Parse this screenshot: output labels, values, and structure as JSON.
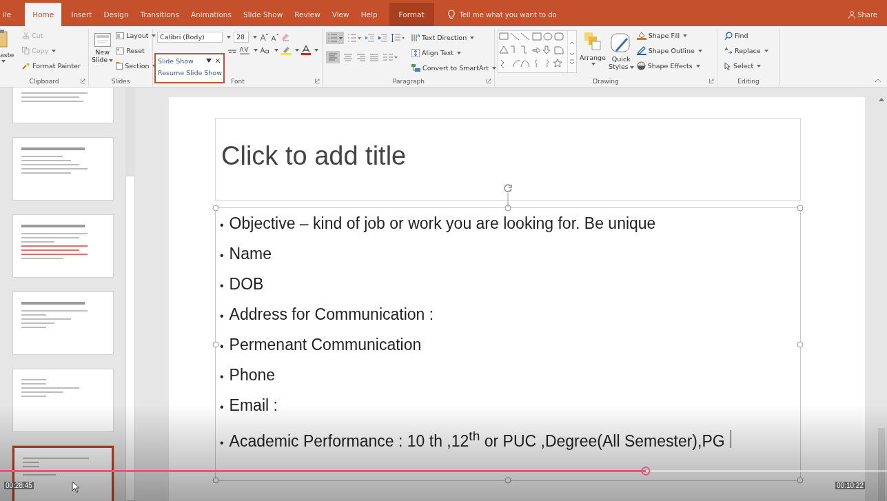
{
  "ribbon": {
    "tabs": [
      {
        "label": "ile",
        "kind": "tab",
        "selected": false
      },
      {
        "label": "Home",
        "kind": "tab",
        "selected": true
      },
      {
        "label": "Insert",
        "kind": "tab",
        "selected": false
      },
      {
        "label": "Design",
        "kind": "tab",
        "selected": false
      },
      {
        "label": "Transitions",
        "kind": "tab",
        "selected": false
      },
      {
        "label": "Animations",
        "kind": "tab",
        "selected": false
      },
      {
        "label": "Slide Show",
        "kind": "tab",
        "selected": false
      },
      {
        "label": "Review",
        "kind": "tab",
        "selected": false
      },
      {
        "label": "View",
        "kind": "tab",
        "selected": false
      },
      {
        "label": "Help",
        "kind": "tab",
        "selected": false
      },
      {
        "label": "Format",
        "kind": "contextual",
        "selected": false
      }
    ],
    "tell_me": "Tell me what you want to do",
    "share": "Share",
    "clipboard": {
      "paste": "aste",
      "cut": {
        "label": "Cut",
        "disabled": true
      },
      "copy": {
        "label": "Copy",
        "disabled": true
      },
      "format_painter": {
        "label": "Format Painter",
        "disabled": false
      },
      "label": "Clipboard"
    },
    "slides": {
      "new_slide": [
        "New",
        "Slide"
      ],
      "layout": "Layout",
      "reset": "Reset",
      "section": "Section",
      "label": "Slides"
    },
    "font": {
      "name": "Calibri (Body)",
      "size": "28",
      "label": "Font"
    },
    "slide_show_popup": {
      "title": "Slide Show",
      "action": "Resume Slide Show"
    },
    "paragraph": {
      "text_direction": "Text Direction",
      "align_text": "Align Text",
      "smartart": "Convert to SmartArt",
      "label": "Paragraph"
    },
    "drawing": {
      "arrange": "Arrange",
      "quick_styles": [
        "Quick",
        "Styles"
      ],
      "shape_fill": "Shape Fill",
      "shape_outline": "Shape Outline",
      "shape_effects": "Shape Effects",
      "label": "Drawing"
    },
    "editing": {
      "find": "Find",
      "replace": "Replace",
      "select": "Select",
      "label": "Editing"
    }
  },
  "thumbnails": [
    {
      "selected": false
    },
    {
      "selected": false
    },
    {
      "selected": false
    },
    {
      "selected": false
    },
    {
      "selected": false
    },
    {
      "selected": true
    }
  ],
  "slide": {
    "title_placeholder": "Click to add title",
    "bullets": [
      {
        "bullet": "•",
        "text": "Objective – kind of job  or work you are looking for. Be unique"
      },
      {
        "bullet": "•",
        "text": "Name"
      },
      {
        "bullet": "•",
        "text": "DOB"
      },
      {
        "bullet": "•",
        "text": "Address for Communication :"
      },
      {
        "bullet": "•",
        "text": "Permenant Communication"
      },
      {
        "bullet": "•",
        "text": "Phone"
      },
      {
        "bullet": "•",
        "text": "Email :"
      },
      {
        "bullet": "•",
        "text": "Academic Performance : 10 th ,12$^{th}$ or PUC ,Degree(All Semester),PG"
      }
    ]
  },
  "video": {
    "elapsed": "00:28:45",
    "remaining": "00:10:22",
    "level": 0.728
  }
}
